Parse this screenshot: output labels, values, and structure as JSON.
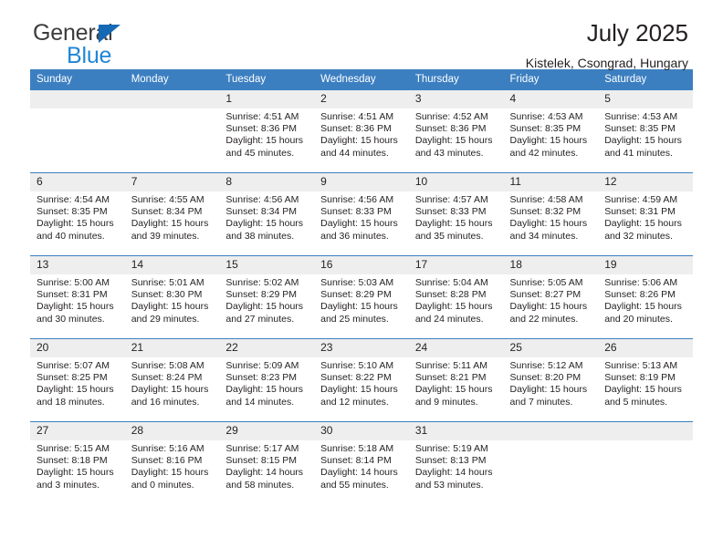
{
  "brand": {
    "word1": "General",
    "word2": "Blue",
    "triangle_color": "#1569b4",
    "blue_text_color": "#1f86d6"
  },
  "header": {
    "title": "July 2025",
    "subtitle": "Kistelek, Csongrad, Hungary"
  },
  "theme": {
    "header_blue": "#3c7fc1",
    "daynum_band": "#eeeeee",
    "text": "#231f20"
  },
  "weekday_headers": [
    "Sunday",
    "Monday",
    "Tuesday",
    "Wednesday",
    "Thursday",
    "Friday",
    "Saturday"
  ],
  "weeks": [
    [
      {
        "day": "",
        "sunrise": "",
        "sunset": "",
        "daylight": ""
      },
      {
        "day": "",
        "sunrise": "",
        "sunset": "",
        "daylight": ""
      },
      {
        "day": "1",
        "sunrise": "Sunrise: 4:51 AM",
        "sunset": "Sunset: 8:36 PM",
        "daylight": "Daylight: 15 hours and 45 minutes."
      },
      {
        "day": "2",
        "sunrise": "Sunrise: 4:51 AM",
        "sunset": "Sunset: 8:36 PM",
        "daylight": "Daylight: 15 hours and 44 minutes."
      },
      {
        "day": "3",
        "sunrise": "Sunrise: 4:52 AM",
        "sunset": "Sunset: 8:36 PM",
        "daylight": "Daylight: 15 hours and 43 minutes."
      },
      {
        "day": "4",
        "sunrise": "Sunrise: 4:53 AM",
        "sunset": "Sunset: 8:35 PM",
        "daylight": "Daylight: 15 hours and 42 minutes."
      },
      {
        "day": "5",
        "sunrise": "Sunrise: 4:53 AM",
        "sunset": "Sunset: 8:35 PM",
        "daylight": "Daylight: 15 hours and 41 minutes."
      }
    ],
    [
      {
        "day": "6",
        "sunrise": "Sunrise: 4:54 AM",
        "sunset": "Sunset: 8:35 PM",
        "daylight": "Daylight: 15 hours and 40 minutes."
      },
      {
        "day": "7",
        "sunrise": "Sunrise: 4:55 AM",
        "sunset": "Sunset: 8:34 PM",
        "daylight": "Daylight: 15 hours and 39 minutes."
      },
      {
        "day": "8",
        "sunrise": "Sunrise: 4:56 AM",
        "sunset": "Sunset: 8:34 PM",
        "daylight": "Daylight: 15 hours and 38 minutes."
      },
      {
        "day": "9",
        "sunrise": "Sunrise: 4:56 AM",
        "sunset": "Sunset: 8:33 PM",
        "daylight": "Daylight: 15 hours and 36 minutes."
      },
      {
        "day": "10",
        "sunrise": "Sunrise: 4:57 AM",
        "sunset": "Sunset: 8:33 PM",
        "daylight": "Daylight: 15 hours and 35 minutes."
      },
      {
        "day": "11",
        "sunrise": "Sunrise: 4:58 AM",
        "sunset": "Sunset: 8:32 PM",
        "daylight": "Daylight: 15 hours and 34 minutes."
      },
      {
        "day": "12",
        "sunrise": "Sunrise: 4:59 AM",
        "sunset": "Sunset: 8:31 PM",
        "daylight": "Daylight: 15 hours and 32 minutes."
      }
    ],
    [
      {
        "day": "13",
        "sunrise": "Sunrise: 5:00 AM",
        "sunset": "Sunset: 8:31 PM",
        "daylight": "Daylight: 15 hours and 30 minutes."
      },
      {
        "day": "14",
        "sunrise": "Sunrise: 5:01 AM",
        "sunset": "Sunset: 8:30 PM",
        "daylight": "Daylight: 15 hours and 29 minutes."
      },
      {
        "day": "15",
        "sunrise": "Sunrise: 5:02 AM",
        "sunset": "Sunset: 8:29 PM",
        "daylight": "Daylight: 15 hours and 27 minutes."
      },
      {
        "day": "16",
        "sunrise": "Sunrise: 5:03 AM",
        "sunset": "Sunset: 8:29 PM",
        "daylight": "Daylight: 15 hours and 25 minutes."
      },
      {
        "day": "17",
        "sunrise": "Sunrise: 5:04 AM",
        "sunset": "Sunset: 8:28 PM",
        "daylight": "Daylight: 15 hours and 24 minutes."
      },
      {
        "day": "18",
        "sunrise": "Sunrise: 5:05 AM",
        "sunset": "Sunset: 8:27 PM",
        "daylight": "Daylight: 15 hours and 22 minutes."
      },
      {
        "day": "19",
        "sunrise": "Sunrise: 5:06 AM",
        "sunset": "Sunset: 8:26 PM",
        "daylight": "Daylight: 15 hours and 20 minutes."
      }
    ],
    [
      {
        "day": "20",
        "sunrise": "Sunrise: 5:07 AM",
        "sunset": "Sunset: 8:25 PM",
        "daylight": "Daylight: 15 hours and 18 minutes."
      },
      {
        "day": "21",
        "sunrise": "Sunrise: 5:08 AM",
        "sunset": "Sunset: 8:24 PM",
        "daylight": "Daylight: 15 hours and 16 minutes."
      },
      {
        "day": "22",
        "sunrise": "Sunrise: 5:09 AM",
        "sunset": "Sunset: 8:23 PM",
        "daylight": "Daylight: 15 hours and 14 minutes."
      },
      {
        "day": "23",
        "sunrise": "Sunrise: 5:10 AM",
        "sunset": "Sunset: 8:22 PM",
        "daylight": "Daylight: 15 hours and 12 minutes."
      },
      {
        "day": "24",
        "sunrise": "Sunrise: 5:11 AM",
        "sunset": "Sunset: 8:21 PM",
        "daylight": "Daylight: 15 hours and 9 minutes."
      },
      {
        "day": "25",
        "sunrise": "Sunrise: 5:12 AM",
        "sunset": "Sunset: 8:20 PM",
        "daylight": "Daylight: 15 hours and 7 minutes."
      },
      {
        "day": "26",
        "sunrise": "Sunrise: 5:13 AM",
        "sunset": "Sunset: 8:19 PM",
        "daylight": "Daylight: 15 hours and 5 minutes."
      }
    ],
    [
      {
        "day": "27",
        "sunrise": "Sunrise: 5:15 AM",
        "sunset": "Sunset: 8:18 PM",
        "daylight": "Daylight: 15 hours and 3 minutes."
      },
      {
        "day": "28",
        "sunrise": "Sunrise: 5:16 AM",
        "sunset": "Sunset: 8:16 PM",
        "daylight": "Daylight: 15 hours and 0 minutes."
      },
      {
        "day": "29",
        "sunrise": "Sunrise: 5:17 AM",
        "sunset": "Sunset: 8:15 PM",
        "daylight": "Daylight: 14 hours and 58 minutes."
      },
      {
        "day": "30",
        "sunrise": "Sunrise: 5:18 AM",
        "sunset": "Sunset: 8:14 PM",
        "daylight": "Daylight: 14 hours and 55 minutes."
      },
      {
        "day": "31",
        "sunrise": "Sunrise: 5:19 AM",
        "sunset": "Sunset: 8:13 PM",
        "daylight": "Daylight: 14 hours and 53 minutes."
      },
      {
        "day": "",
        "sunrise": "",
        "sunset": "",
        "daylight": ""
      },
      {
        "day": "",
        "sunrise": "",
        "sunset": "",
        "daylight": ""
      }
    ]
  ]
}
